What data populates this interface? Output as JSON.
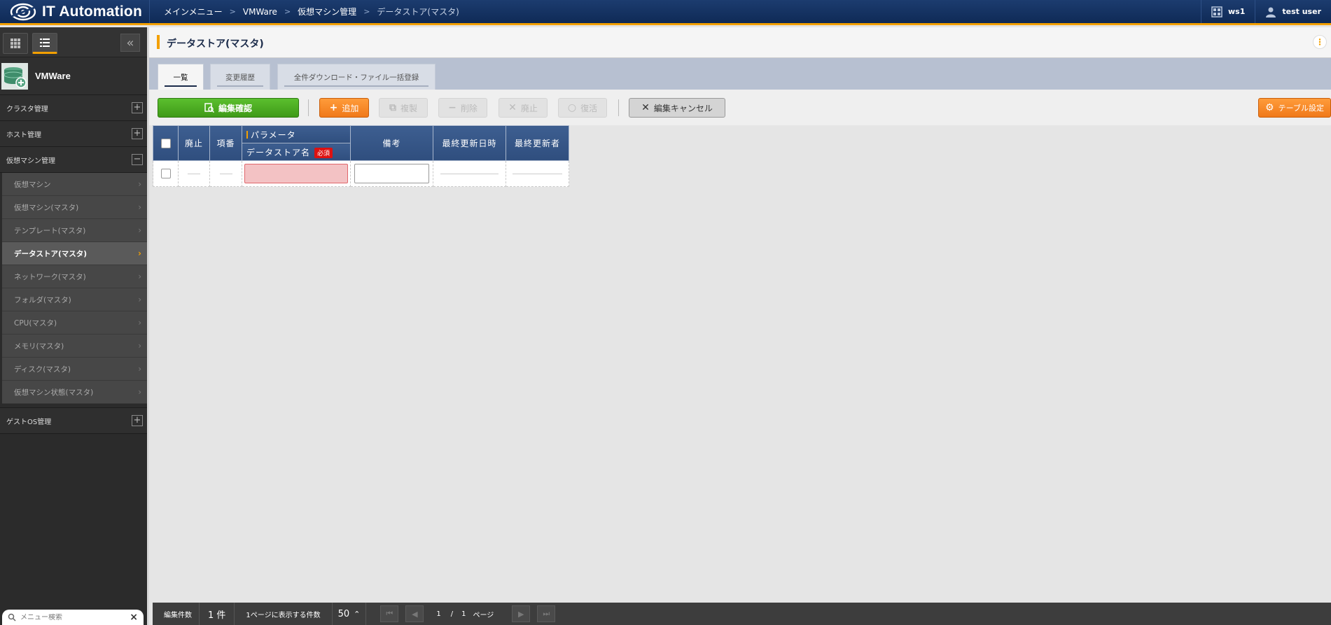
{
  "header": {
    "app_title": "IT Automation",
    "breadcrumb": [
      "メインメニュー",
      "VMWare",
      "仮想マシン管理",
      "データストア(マスタ)"
    ],
    "workspace": "ws1",
    "user": "test user"
  },
  "sidebar": {
    "app_name": "VMWare",
    "groups": [
      {
        "label": "クラスタ管理",
        "expanded": false
      },
      {
        "label": "ホスト管理",
        "expanded": false
      },
      {
        "label": "仮想マシン管理",
        "expanded": true
      }
    ],
    "items": [
      {
        "label": "仮想マシン"
      },
      {
        "label": "仮想マシン(マスタ)"
      },
      {
        "label": "テンプレート(マスタ)"
      },
      {
        "label": "データストア(マスタ)",
        "active": true
      },
      {
        "label": "ネットワーク(マスタ)"
      },
      {
        "label": "フォルダ(マスタ)"
      },
      {
        "label": "CPU(マスタ)"
      },
      {
        "label": "メモリ(マスタ)"
      },
      {
        "label": "ディスク(マスタ)"
      },
      {
        "label": "仮想マシン状態(マスタ)"
      }
    ],
    "group_after": {
      "label": "ゲストOS管理"
    },
    "search_placeholder": "メニュー検索"
  },
  "page": {
    "title": "データストア(マスタ)",
    "tabs": [
      {
        "label": "一覧",
        "active": true
      },
      {
        "label": "変更履歴"
      },
      {
        "label": "全件ダウンロード・ファイル一括登録"
      }
    ]
  },
  "toolbar": {
    "confirm": "編集確認",
    "add": "追加",
    "copy": "複製",
    "delete": "削除",
    "discard": "廃止",
    "restore": "復活",
    "cancel": "編集キャンセル",
    "table_settings": "テーブル設定"
  },
  "table": {
    "col_discard": "廃止",
    "col_no": "項番",
    "col_group": "パラメータ",
    "col_name": "データストア名",
    "required": "必須",
    "col_remarks": "備考",
    "col_updated_at": "最終更新日時",
    "col_updated_by": "最終更新者"
  },
  "footer": {
    "count_label": "編集件数",
    "count_value": "1 件",
    "per_page_label": "1ページに表示する件数",
    "per_page_value": "50",
    "page_current": "1",
    "page_sep": "/",
    "page_total": "1",
    "page_unit": "ページ"
  },
  "colors": {
    "header_bg": "#0f2a56",
    "accent": "#f3a000",
    "confirm_green": "#4aa820",
    "add_orange": "#f5862a",
    "table_header": "#345488",
    "required_red": "#dd1111"
  }
}
